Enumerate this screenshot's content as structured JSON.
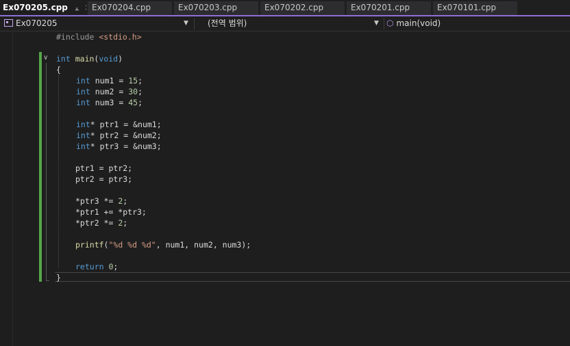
{
  "tabs": [
    {
      "label": "Ex070205.cpp",
      "active": true
    },
    {
      "label": "Ex070204.cpp"
    },
    {
      "label": "Ex070203.cpp"
    },
    {
      "label": "Ex070202.cpp"
    },
    {
      "label": "Ex070201.cpp"
    },
    {
      "label": "Ex070101.cpp"
    }
  ],
  "tab_pin_icon": "pin-icon",
  "tab_close_icon": "close-icon",
  "navbar": {
    "project": "Ex070205",
    "scope": "(전역 범위)",
    "member": "main(void)"
  },
  "code": {
    "line1_pp": "#include ",
    "line1_header": "<stdio.h>",
    "main_kw": "int",
    "main_fn": "main",
    "main_params": "void",
    "open_brace": "{",
    "num1_name": "num1",
    "num1_val": "15",
    "num2_name": "num2",
    "num2_val": "30",
    "num3_name": "num3",
    "num3_val": "45",
    "int_kw": "int",
    "ptr1_decl": "ptr1 = &num1;",
    "ptr2_decl": "ptr2 = &num2;",
    "ptr3_decl": "ptr3 = &num3;",
    "assign1": "ptr1 = ptr2;",
    "assign2": "ptr2 = ptr3;",
    "op1": "*ptr3 *= ",
    "op1_val": "2",
    "op2": "*ptr1 += *ptr3;",
    "op3": "*ptr2 *= ",
    "op3_val": "2",
    "printf_fn": "printf",
    "printf_fmt": "\"%d %d %d\"",
    "printf_args": ", num1, num2, num3);",
    "return_kw": "return",
    "return_val": "0",
    "close_brace": "}"
  },
  "colors": {
    "keyword": "#569cd6",
    "function": "#dcdcaa",
    "string": "#d69d85",
    "number": "#b5cea8",
    "preprocessor": "#9b9b9b",
    "change_bar": "#57a64a",
    "tab_accent": "#8f6fd6"
  }
}
